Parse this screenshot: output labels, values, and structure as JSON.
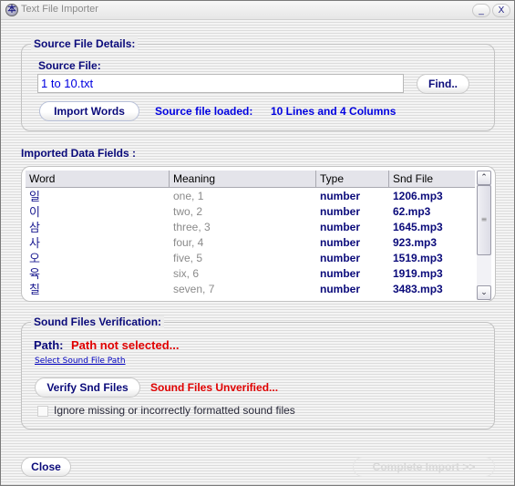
{
  "window": {
    "title": "Text File Importer",
    "icon": "app-emblem-icon",
    "icon_glyph": "本",
    "minimize_label": "_",
    "close_label": "X"
  },
  "source": {
    "legend": "Source File Details:",
    "file_label": "Source File:",
    "file_value": "1 to 10.txt",
    "find_button": "Find..",
    "import_button": "Import Words",
    "status_label": "Source file loaded:",
    "status_value": "10 Lines and 4 Columns"
  },
  "imported": {
    "legend": "Imported Data Fields :",
    "columns": [
      "Word",
      "Meaning",
      "Type",
      "Snd File"
    ],
    "rows": [
      {
        "word": "일",
        "meaning": "one, 1",
        "type": "number",
        "snd": "1206.mp3"
      },
      {
        "word": "이",
        "meaning": "two, 2",
        "type": "number",
        "snd": "62.mp3"
      },
      {
        "word": "삼",
        "meaning": "three, 3",
        "type": "number",
        "snd": "1645.mp3"
      },
      {
        "word": "사",
        "meaning": "four, 4",
        "type": "number",
        "snd": "923.mp3"
      },
      {
        "word": "오",
        "meaning": "five, 5",
        "type": "number",
        "snd": "1519.mp3"
      },
      {
        "word": "육",
        "meaning": "six, 6",
        "type": "number",
        "snd": "1919.mp3"
      },
      {
        "word": "칠",
        "meaning": "seven, 7",
        "type": "number",
        "snd": "3483.mp3"
      }
    ],
    "scroll": {
      "up_glyph": "⌃",
      "down_glyph": "⌄",
      "thumb_glyph": "≡",
      "visible_fraction": 0.7,
      "position": 0
    }
  },
  "sound": {
    "legend": "Sound Files Verification:",
    "path_label": "Path:",
    "path_value": "Path not selected...",
    "select_link": "Select Sound File Path",
    "verify_button": "Verify Snd Files",
    "verify_status": "Sound Files Unverified...",
    "ignore_checkbox_label": "Ignore missing or incorrectly formatted sound files",
    "ignore_checked": false
  },
  "footer": {
    "close_button": "Close",
    "complete_button": "Complete Import >>"
  },
  "colors": {
    "navy": "#0a0a7a",
    "blue": "#0000e0",
    "error_red": "#e00000",
    "muted_gray": "#8a8a8a"
  }
}
